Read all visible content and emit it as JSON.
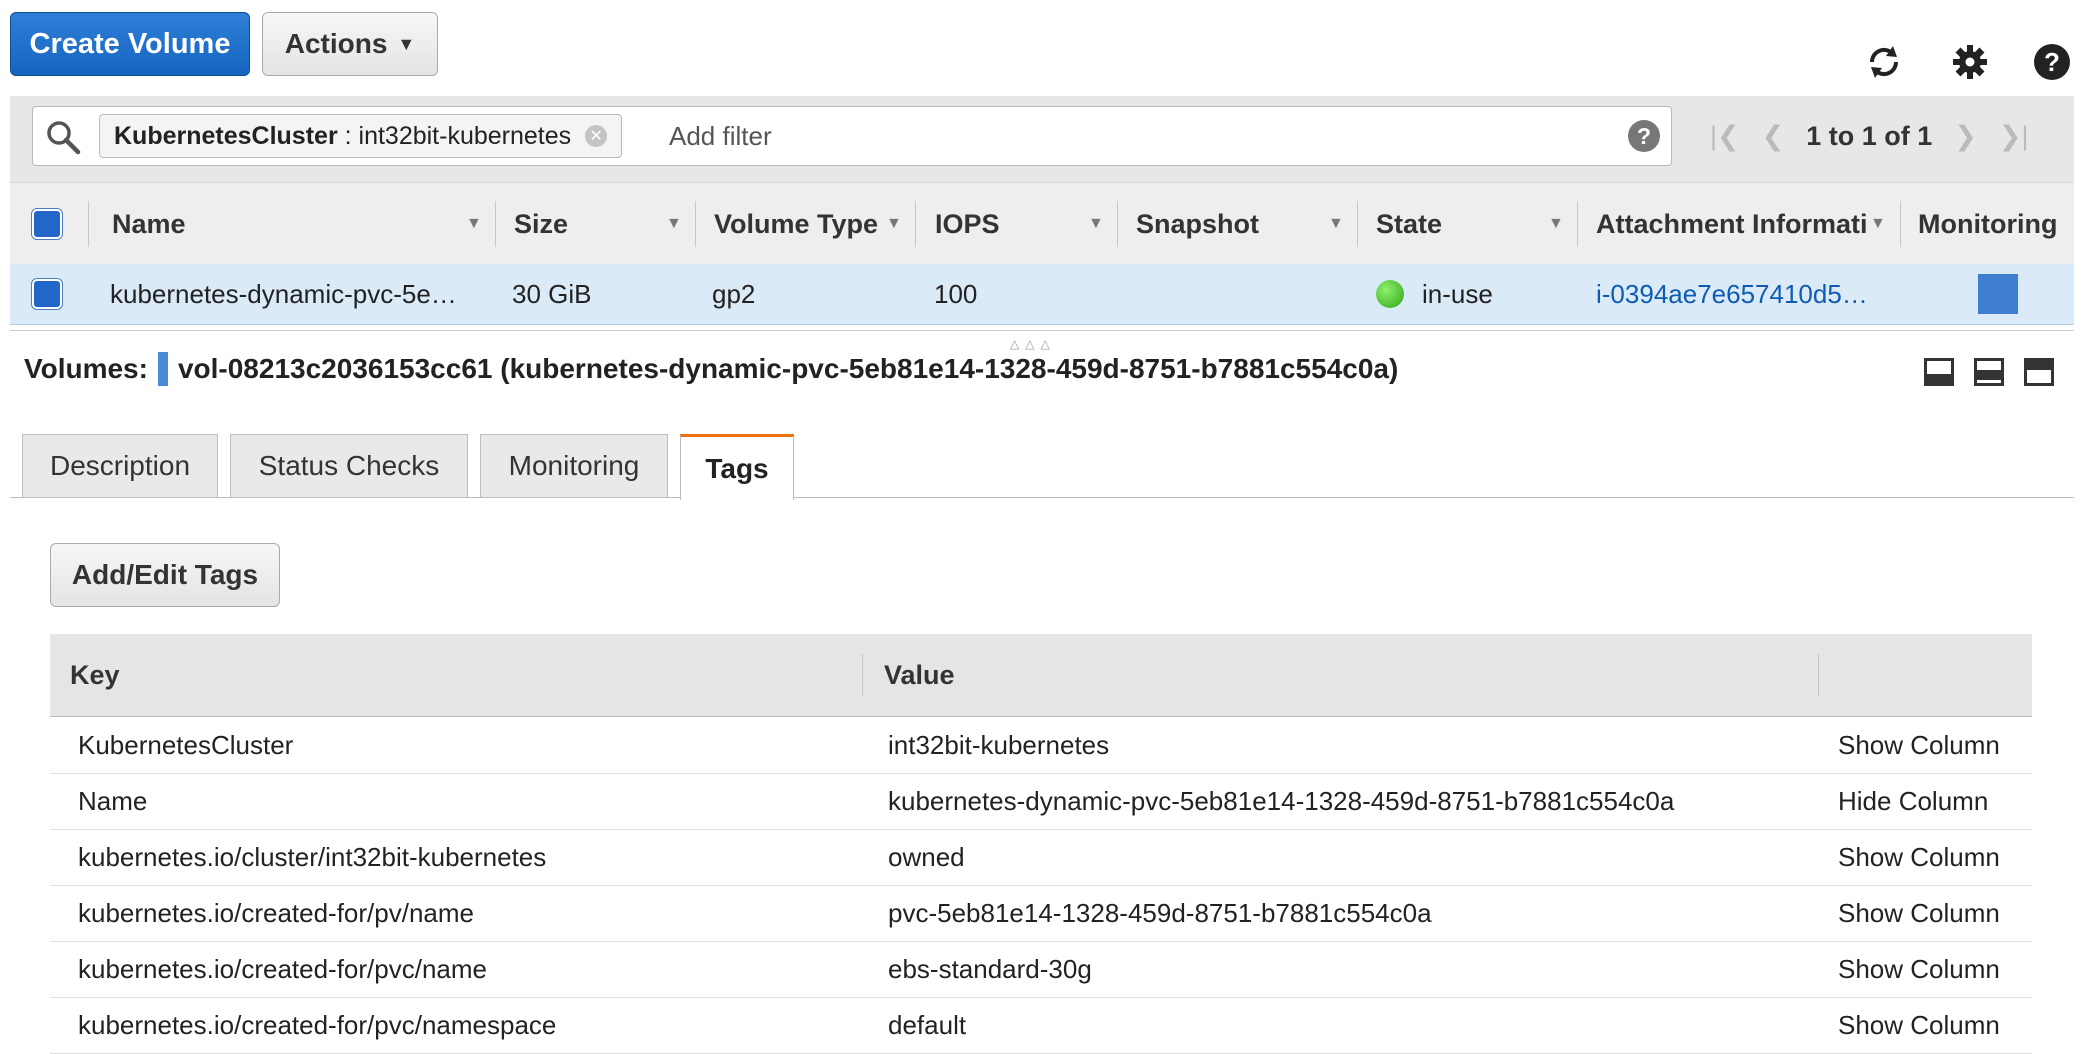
{
  "toolbar": {
    "create_label": "Create Volume",
    "actions_label": "Actions"
  },
  "filter": {
    "chip_key": "KubernetesCluster",
    "chip_sep": " : ",
    "chip_value": "int32bit-kubernetes",
    "placeholder": "Add filter",
    "pagination": "1 to 1 of 1"
  },
  "table": {
    "headers": [
      "Name",
      "Size",
      "Volume Type",
      "IOPS",
      "Snapshot",
      "State",
      "Attachment Informati",
      "Monitoring"
    ],
    "rows": [
      {
        "name": "kubernetes-dynamic-pvc-5e…",
        "size": "30 GiB",
        "volume_type": "gp2",
        "iops": "100",
        "snapshot": "",
        "state": "in-use",
        "attachment": "i-0394ae7e657410d5…"
      }
    ]
  },
  "detail": {
    "prefix": "Volumes:",
    "title": "vol-08213c2036153cc61 (kubernetes-dynamic-pvc-5eb81e14-1328-459d-8751-b7881c554c0a)",
    "tabs": [
      "Description",
      "Status Checks",
      "Monitoring",
      "Tags"
    ],
    "active_tab": "Tags",
    "add_edit_label": "Add/Edit Tags"
  },
  "tags": {
    "headers": [
      "Key",
      "Value"
    ],
    "rows": [
      {
        "key": "KubernetesCluster",
        "value": "int32bit-kubernetes",
        "action": "Show Column"
      },
      {
        "key": "Name",
        "value": "kubernetes-dynamic-pvc-5eb81e14-1328-459d-8751-b7881c554c0a",
        "action": "Hide Column"
      },
      {
        "key": "kubernetes.io/cluster/int32bit-kubernetes",
        "value": "owned",
        "action": "Show Column"
      },
      {
        "key": "kubernetes.io/created-for/pv/name",
        "value": "pvc-5eb81e14-1328-459d-8751-b7881c554c0a",
        "action": "Show Column"
      },
      {
        "key": "kubernetes.io/created-for/pvc/name",
        "value": "ebs-standard-30g",
        "action": "Show Column"
      },
      {
        "key": "kubernetes.io/created-for/pvc/namespace",
        "value": "default",
        "action": "Show Column"
      }
    ]
  },
  "colors": {
    "primary": "#1565c0",
    "accent_tab": "#ec7211",
    "link": "#0d5bb5",
    "status_green": "#3cb521",
    "row_selected": "#dbeaf7"
  },
  "icons": [
    "search-icon",
    "refresh-icon",
    "gear-icon",
    "help-icon",
    "clear-chip-icon",
    "first-page-icon",
    "prev-page-icon",
    "next-page-icon",
    "last-page-icon",
    "status-dot-icon",
    "monitoring-icon"
  ]
}
